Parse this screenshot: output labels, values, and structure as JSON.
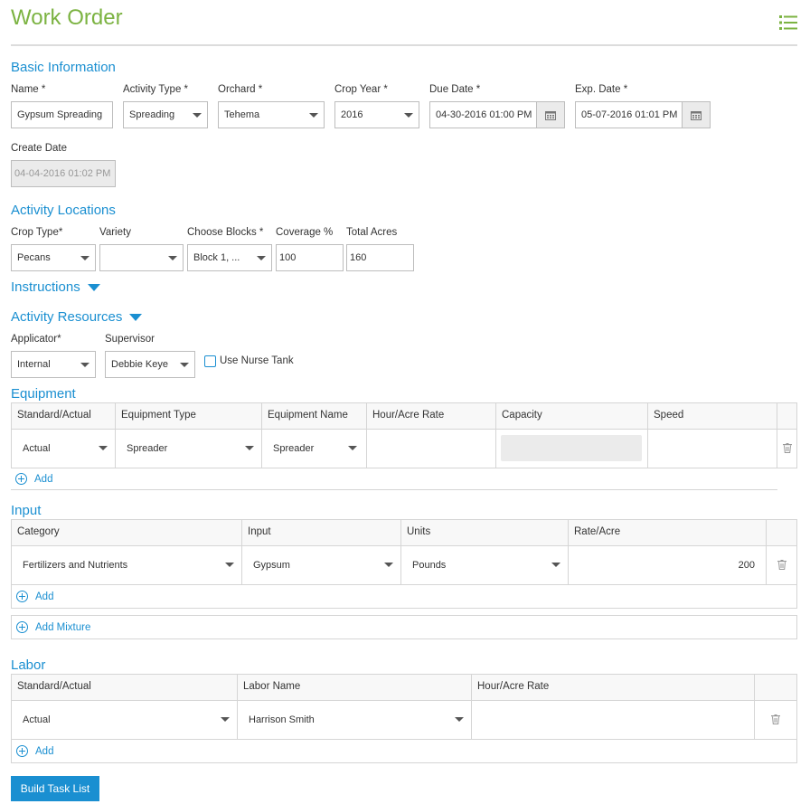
{
  "header": {
    "title": "Work Order",
    "menu_icon": "list-icon"
  },
  "basic": {
    "section": "Basic Information",
    "name_label": "Name *",
    "name_value": "Gypsum Spreading",
    "activity_label": "Activity Type *",
    "activity_value": "Spreading",
    "orchard_label": "Orchard *",
    "orchard_value": "Tehema",
    "crop_year_label": "Crop Year *",
    "crop_year_value": "2016",
    "due_label": "Due Date *",
    "due_value": "04-30-2016 01:00 PM",
    "exp_label": "Exp. Date *",
    "exp_value": "05-07-2016 01:01 PM",
    "create_label": "Create Date",
    "create_value": "04-04-2016 01:02 PM"
  },
  "locations": {
    "section": "Activity Locations",
    "crop_type_label": "Crop Type*",
    "crop_type_value": "Pecans",
    "variety_label": "Variety",
    "variety_value": "",
    "blocks_label": "Choose Blocks *",
    "blocks_value": "Block 1, ...",
    "coverage_label": "Coverage %",
    "coverage_value": "100",
    "acres_label": "Total Acres",
    "acres_value": "160"
  },
  "instructions": {
    "section": "Instructions"
  },
  "resources": {
    "section": "Activity Resources",
    "applicator_label": "Applicator*",
    "applicator_value": "Internal",
    "supervisor_label": "Supervisor",
    "supervisor_value": "Debbie Keye",
    "nurse_tank_label": "Use Nurse Tank",
    "nurse_tank_checked": false
  },
  "equipment": {
    "section": "Equipment",
    "headers": [
      "Standard/Actual",
      "Equipment Type",
      "Equipment Name",
      "Hour/Acre Rate",
      "Capacity",
      "Speed"
    ],
    "row": {
      "standard": "Actual",
      "type": "Spreader",
      "name": "Spreader",
      "rate": "",
      "capacity": "",
      "speed": ""
    },
    "add_label": "Add"
  },
  "input": {
    "section": "Input",
    "headers": [
      "Category",
      "Input",
      "Units",
      "Rate/Acre"
    ],
    "row": {
      "category": "Fertilizers and Nutrients",
      "input": "Gypsum",
      "units": "Pounds",
      "rate": "200"
    },
    "add_label": "Add",
    "add_mixture_label": "Add Mixture"
  },
  "labor": {
    "section": "Labor",
    "headers": [
      "Standard/Actual",
      "Labor Name",
      "Hour/Acre Rate"
    ],
    "row": {
      "standard": "Actual",
      "name": "Harrison Smith",
      "rate": ""
    },
    "add_label": "Add"
  },
  "actions": {
    "build_label": "Build Task List"
  },
  "colors": {
    "title": "#7cb342",
    "accent": "#1a8fd1"
  }
}
